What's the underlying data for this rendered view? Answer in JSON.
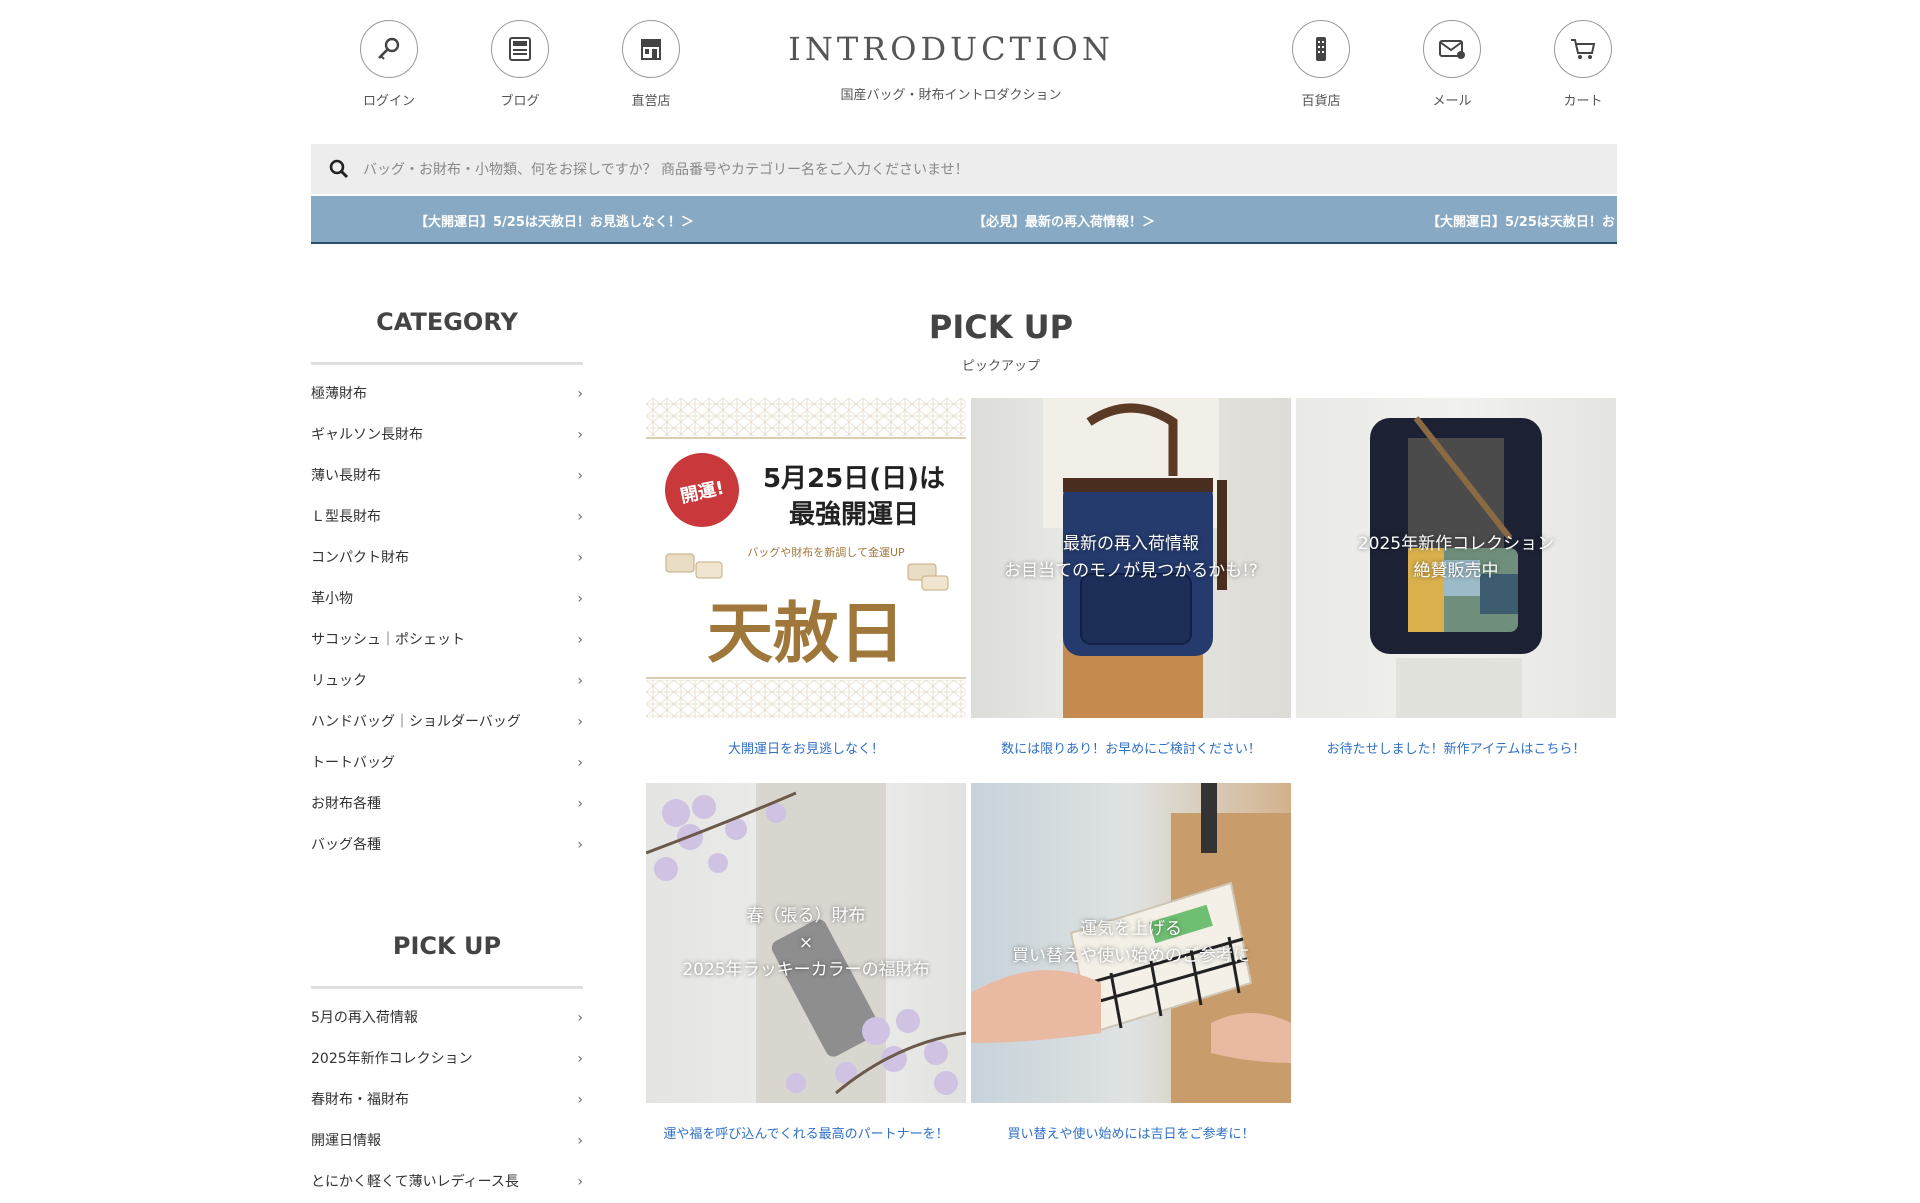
{
  "header": {
    "logo": "INTRODUCTION",
    "logo_sub": "国産バッグ・財布イントロダクション",
    "nav_left": [
      {
        "label": "ログイン",
        "icon": "key-icon"
      },
      {
        "label": "ブログ",
        "icon": "blog-icon"
      },
      {
        "label": "直営店",
        "icon": "store-icon"
      }
    ],
    "nav_right": [
      {
        "label": "百貨店",
        "icon": "department-store-icon"
      },
      {
        "label": "メール",
        "icon": "mail-icon"
      },
      {
        "label": "カート",
        "icon": "cart-icon"
      }
    ]
  },
  "search": {
    "placeholder": "バッグ・お財布・小物類、何をお探しですか？ 商品番号やカテゴリー名をご入力くださいませ！"
  },
  "ticker": [
    "【大開運日】5/25は天赦日！お見逃しなく！＞",
    "【必見】最新の再入荷情報！＞",
    "【大開運日】5/25は天赦日！お"
  ],
  "sidebar": {
    "category_title": "CATEGORY",
    "categories": [
      "極薄財布",
      "ギャルソン長財布",
      "薄い長財布",
      "Ｌ型長財布",
      "コンパクト財布",
      "革小物",
      "サコッシュ｜ポシェット",
      "リュック",
      "ハンドバッグ｜ショルダーバッグ",
      "トートバッグ",
      "お財布各種",
      "バッグ各種"
    ],
    "pickup_title": "PICK UP",
    "pickups": [
      "5月の再入荷情報",
      "2025年新作コレクション",
      "春財布・福財布",
      "開運日情報",
      "とにかく軽くて薄いレディース長"
    ]
  },
  "main": {
    "title": "PICK UP",
    "subtitle": "ピックアップ",
    "banner": {
      "badge": "開運!",
      "date_line": "5月25日(日)は",
      "strong_line": "最強開運日",
      "small_line": "バッグや財布を新調して金運UP",
      "big_text": "天赦日"
    },
    "cards": [
      {
        "overlay": [],
        "caption": "大開運日をお見逃しなく！"
      },
      {
        "overlay": [
          "最新の再入荷情報",
          "お目当てのモノが見つかるかも!?"
        ],
        "caption": "数には限りあり！お早めにご検討ください！"
      },
      {
        "overlay": [
          "2025年新作コレクション",
          "絶賛販売中"
        ],
        "caption": "お待たせしました！新作アイテムはこちら！"
      },
      {
        "overlay": [
          "春（張る）財布",
          "×",
          "2025年ラッキーカラーの福財布"
        ],
        "caption": "運や福を呼び込んでくれる最高のパートナーを！"
      },
      {
        "overlay": [
          "運気を上げる",
          "買い替えや使い始めのご参考に"
        ],
        "caption": "買い替えや使い始めには吉日をご参考に！"
      }
    ]
  },
  "colors": {
    "ticker_bg": "#87a9c4",
    "caption": "#2f6fc7",
    "banner_gold": "#a0773a",
    "badge_red": "#c9393b"
  }
}
